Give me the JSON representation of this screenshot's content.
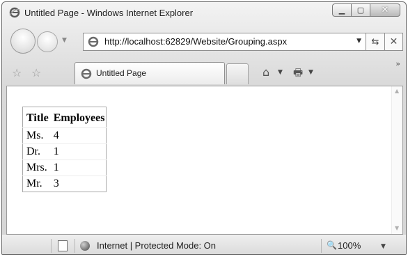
{
  "window": {
    "title": "Untitled Page - Windows Internet Explorer"
  },
  "address_bar": {
    "url": "http://localhost:62829/Website/Grouping.aspx"
  },
  "tab": {
    "label": "Untitled Page"
  },
  "table": {
    "headers": [
      "Title",
      "Employees"
    ],
    "rows": [
      [
        "Ms.",
        "4"
      ],
      [
        "Dr.",
        "1"
      ],
      [
        "Mrs.",
        "1"
      ],
      [
        "Mr.",
        "3"
      ]
    ]
  },
  "status_bar": {
    "zone": "Internet | Protected Mode: On",
    "zoom": "100%"
  },
  "icons": {
    "ie": "ie-logo-icon",
    "back": "back-arrow-icon",
    "forward": "forward-arrow-icon",
    "refresh": "refresh-icon",
    "stop": "stop-x-icon",
    "favorites": "star-icon",
    "add_favorites": "add-favorite-icon",
    "home": "home-icon",
    "print": "printer-icon",
    "globe": "globe-icon",
    "zoom": "magnifier-icon"
  }
}
